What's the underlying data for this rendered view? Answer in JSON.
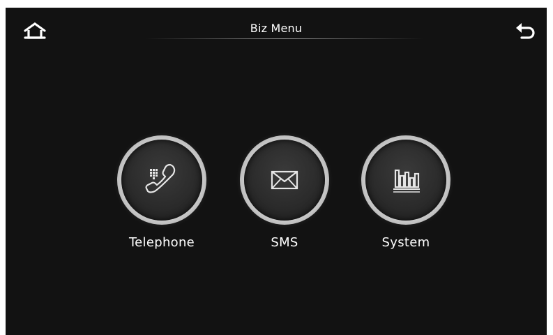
{
  "header": {
    "title": "Biz Menu",
    "home_icon": "home-icon",
    "back_icon": "back-arrow-icon"
  },
  "menu": {
    "items": [
      {
        "label": "Telephone",
        "icon": "telephone-keypad-icon"
      },
      {
        "label": "SMS",
        "icon": "envelope-icon"
      },
      {
        "label": "System",
        "icon": "bar-chart-icon"
      }
    ]
  },
  "colors": {
    "background": "#121212",
    "text": "#ffffff",
    "ring": "#d0d0d0",
    "icon": "#e0e0e0"
  }
}
